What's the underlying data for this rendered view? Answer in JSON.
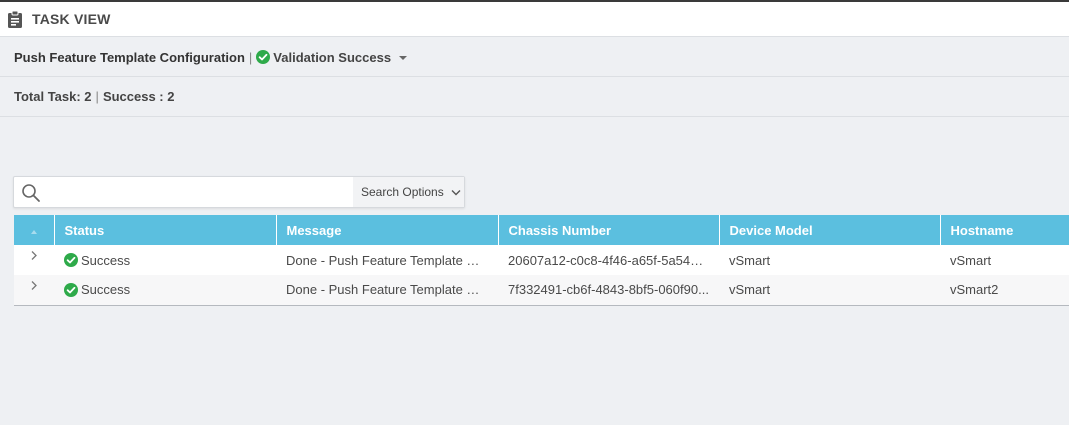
{
  "header": {
    "title": "TASK VIEW",
    "icon": "clipboard-icon"
  },
  "task": {
    "name": "Push Feature Template Configuration",
    "separator": "|",
    "validation_status": "Validation Success",
    "status_icon": "check-circle-icon",
    "status_color": "#2eaa4a"
  },
  "summary": {
    "total_label": "Total Task: 2",
    "separator": "|",
    "success_label": "Success : 2"
  },
  "search": {
    "value": "",
    "placeholder": "",
    "options_label": "Search Options",
    "icon": "search-icon"
  },
  "table": {
    "header_color": "#5bbfdf",
    "columns": [
      "Status",
      "Message",
      "Chassis Number",
      "Device Model",
      "Hostname"
    ],
    "rows": [
      {
        "status": "Success",
        "message": "Done - Push Feature Template Con...",
        "chassis": "20607a12-c0c8-4f46-a65f-5a547c...",
        "model": "vSmart",
        "hostname": "vSmart"
      },
      {
        "status": "Success",
        "message": "Done - Push Feature Template Con...",
        "chassis": "7f332491-cb6f-4843-8bf5-060f90...",
        "model": "vSmart",
        "hostname": "vSmart2"
      }
    ]
  }
}
